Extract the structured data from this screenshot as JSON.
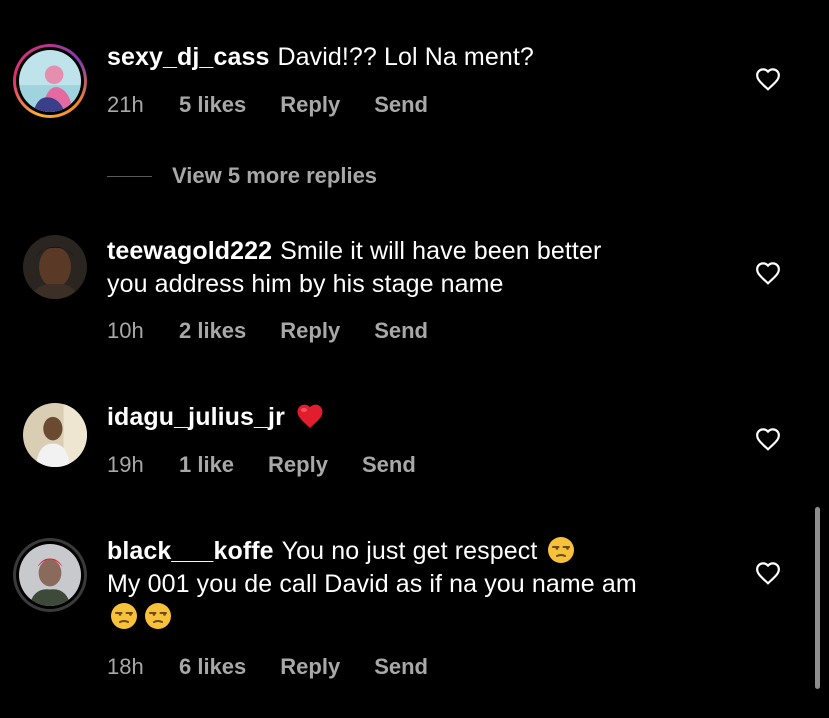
{
  "comments": [
    {
      "username": "sexy_dj_cass",
      "text": "David!?? Lol Na ment?",
      "text_line2": "",
      "time": "21h",
      "likes": "5 likes",
      "reply": "Reply",
      "send": "Send",
      "avatar": "story-ring"
    },
    {
      "username": "teewagold222",
      "text": "Smile it will have been better",
      "text_line2": "you address him by his stage name",
      "time": "10h",
      "likes": "2 likes",
      "reply": "Reply",
      "send": "Send",
      "avatar": "plain"
    },
    {
      "username": "idagu_julius_jr",
      "text": "",
      "emoji": "red-heart",
      "time": "19h",
      "likes": "1 like",
      "reply": "Reply",
      "send": "Send",
      "avatar": "plain"
    },
    {
      "username": "black___koffe",
      "text": "You no just get respect",
      "text_line2": "My 001 you de call David as if na you name am",
      "emoji": "unamused-face",
      "time": "18h",
      "likes": "6 likes",
      "reply": "Reply",
      "send": "Send",
      "avatar": "seen-ring"
    }
  ],
  "view_replies": {
    "label": "View 5 more replies"
  },
  "colors": {
    "background": "#000000",
    "text": "#ffffff",
    "secondary_text": "#a8a8a8",
    "heart_outline": "#ffffff",
    "red_heart": "#e11d2e"
  },
  "icons": {
    "like": "heart-outline-icon",
    "emoji_heart": "red-heart-emoji",
    "emoji_unamused": "unamused-face-emoji"
  }
}
